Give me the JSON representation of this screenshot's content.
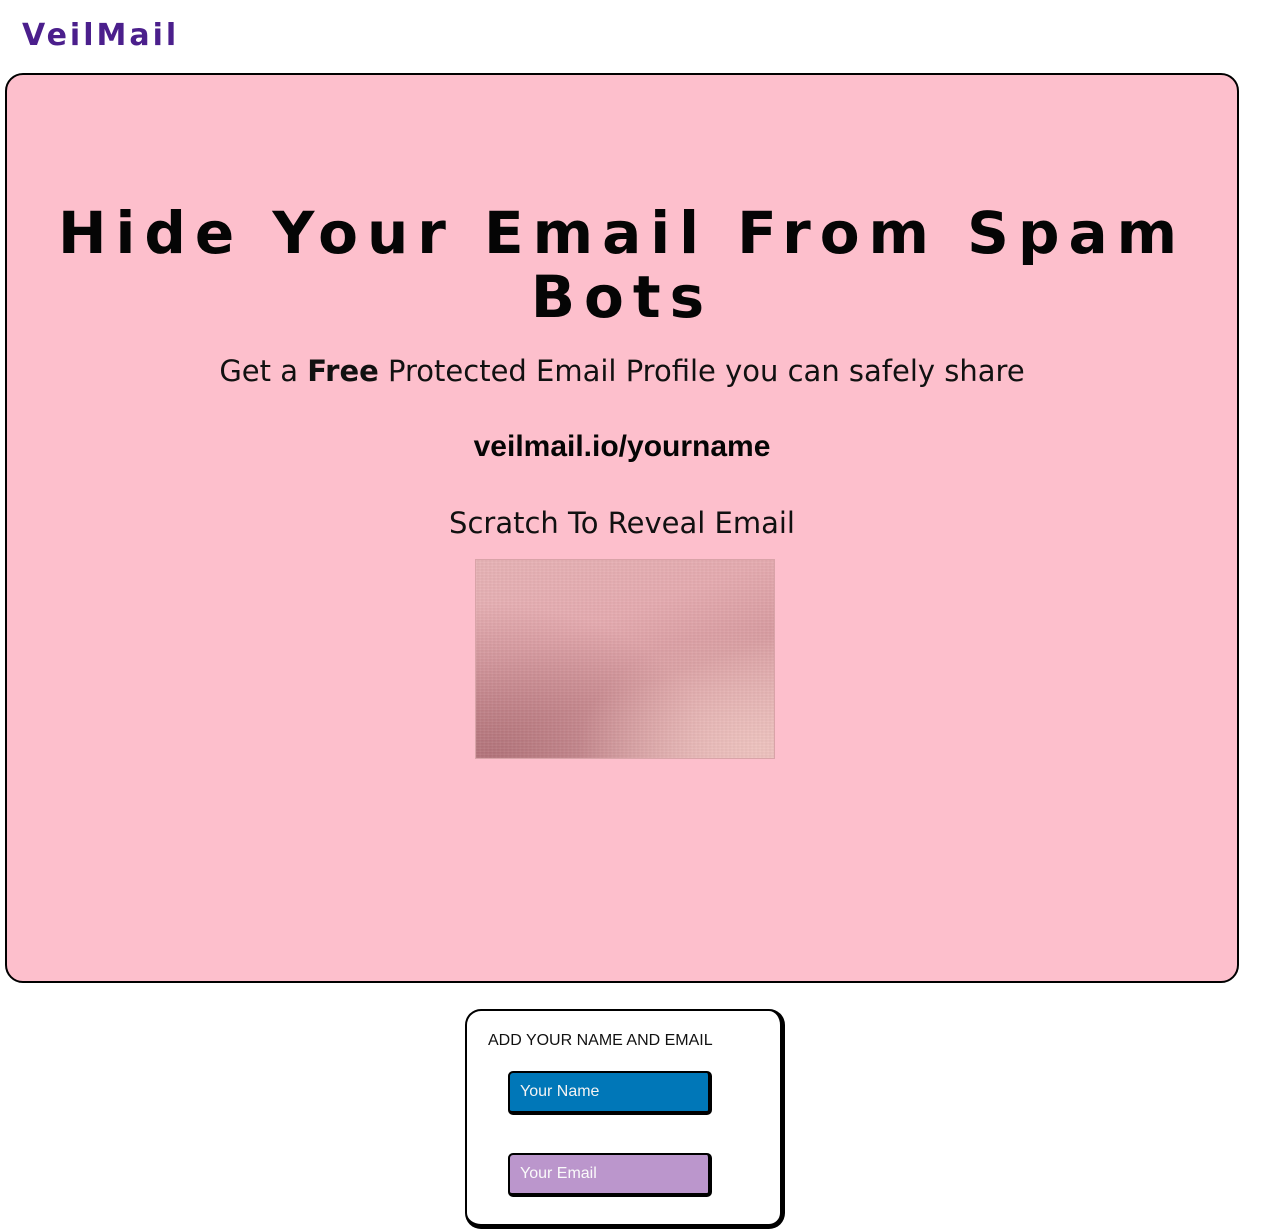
{
  "brand": {
    "logo_text": "VeilMail",
    "logo_color": "#4b1f8c"
  },
  "hero": {
    "background_color": "#fdbfcc",
    "title": "Hide Your Email From Spam Bots",
    "subtitle_prefix": "Get a ",
    "subtitle_bold": "Free",
    "subtitle_suffix": " Protected Email Profile you can safely share",
    "profile_url": "veilmail.io/yourname",
    "scratch_label": "Scratch To Reveal Email",
    "scratch_card_color": "#e3aeb1"
  },
  "signup": {
    "heading": "ADD YOUR NAME AND EMAIL",
    "name_placeholder": "Your Name",
    "name_field_color": "#0077b8",
    "email_placeholder": "Your Email",
    "email_field_color": "#bb96cc"
  }
}
